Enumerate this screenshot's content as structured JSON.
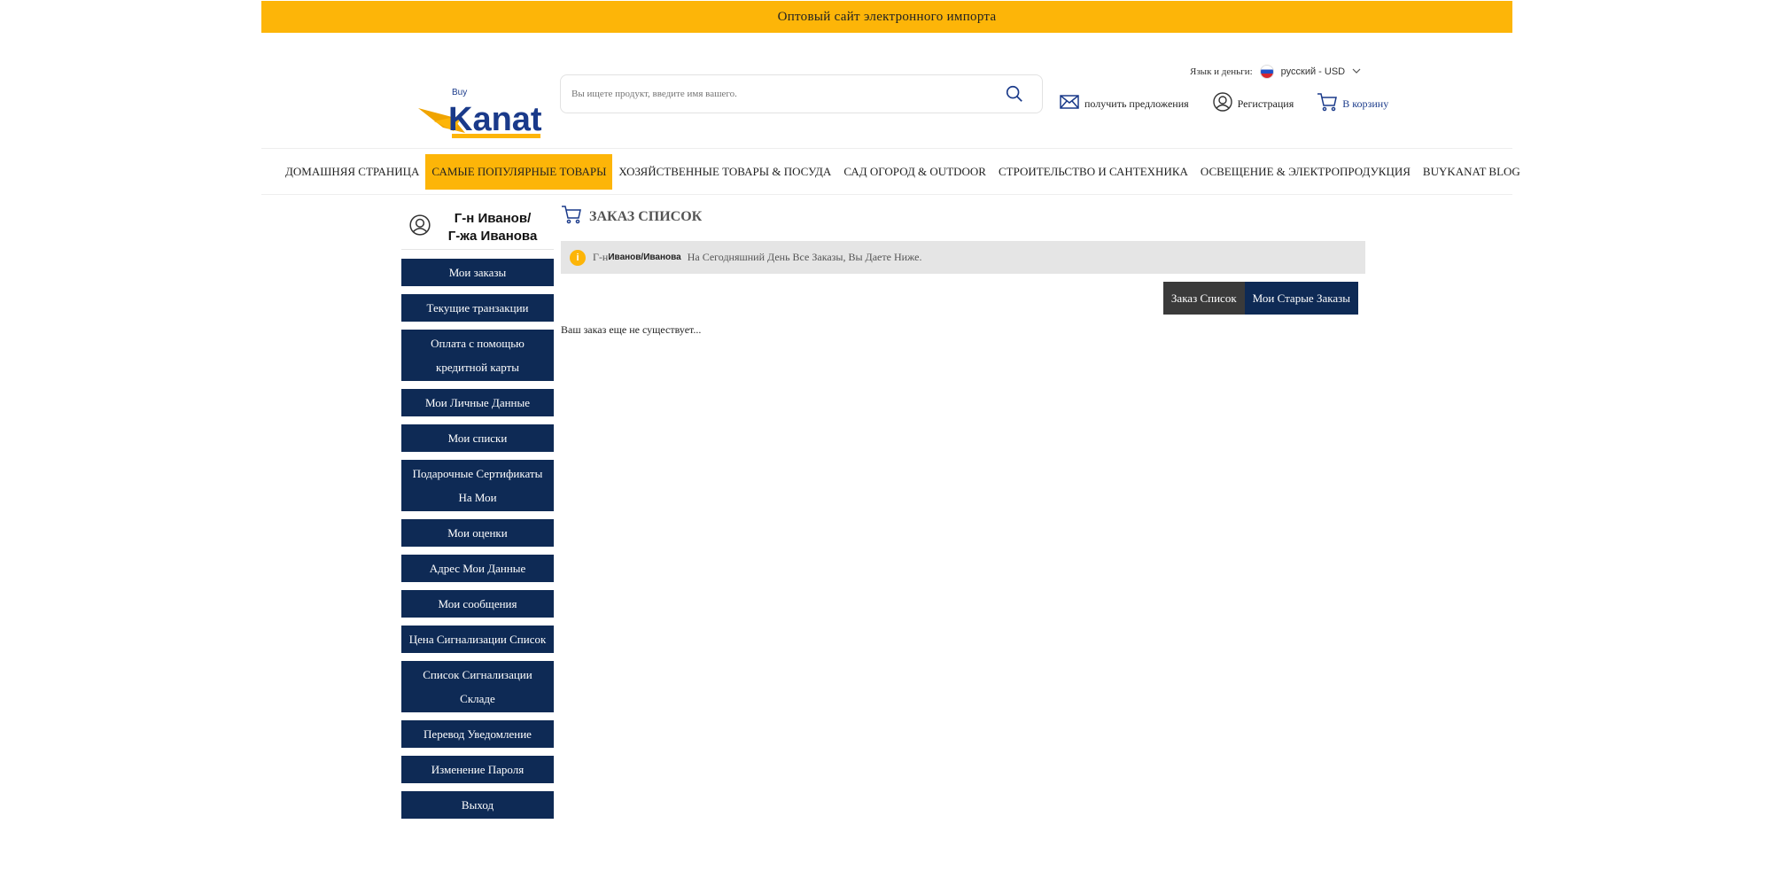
{
  "topbar": {
    "text": "Оптовый сайт электронного импорта"
  },
  "header": {
    "search_placeholder": "Вы ищете продукт, введите имя вашего.",
    "lang_label": "Язык и деньги:",
    "lang_selected": "русский - USD",
    "offers_label": "получить предложения",
    "register_label": "Регистрация",
    "cart_label": "В корзину"
  },
  "nav": {
    "items": [
      "ДОМАШНЯЯ СТРАНИЦА",
      "САМЫЕ ПОПУЛЯРНЫЕ ТОВАРЫ",
      "ХОЗЯЙСТВЕННЫЕ ТОВАРЫ & ПОСУДА",
      "САД ОГОРОД & OUTDOOR",
      "СТРОИТЕЛЬСТВО И САНТЕХНИКА",
      "ОСВЕЩЕНИЕ & ЭЛЕКТРОПРОДУКЦИЯ",
      "BUYKANAT BLOG"
    ]
  },
  "sidebar": {
    "user_name_line1": "Г-н Иванов/",
    "user_name_line2": "Г-жа Иванова",
    "items": [
      "Мои заказы",
      "Текущие транзакции",
      "Оплата с помощью кредитной карты",
      "Мои Личные Данные",
      "Мои списки",
      "Подарочные Сертификаты На Мои",
      "Мои оценки",
      "Адрес Мои Данные",
      "Мои сообщения",
      "Цена Сигнализации Список",
      "Список Сигнализации Складе",
      "Перевод Уведомление",
      "Изменение Пароля",
      "Выход"
    ]
  },
  "main": {
    "title": "ЗАКАЗ СПИСОК",
    "alert_prefix": "Г-н",
    "alert_user": "Иванов/Иванова",
    "alert_text": "На Сегодняшний День Все Заказы, Вы Даете Ниже.",
    "tab_orders": "Заказ Список",
    "tab_old_orders": "Мои Старые Заказы",
    "empty_text": "Ваш заказ еще не существует..."
  },
  "colors": {
    "accent": "#fdb508",
    "navy": "#0e2a55",
    "dark": "#3a3a3a"
  }
}
